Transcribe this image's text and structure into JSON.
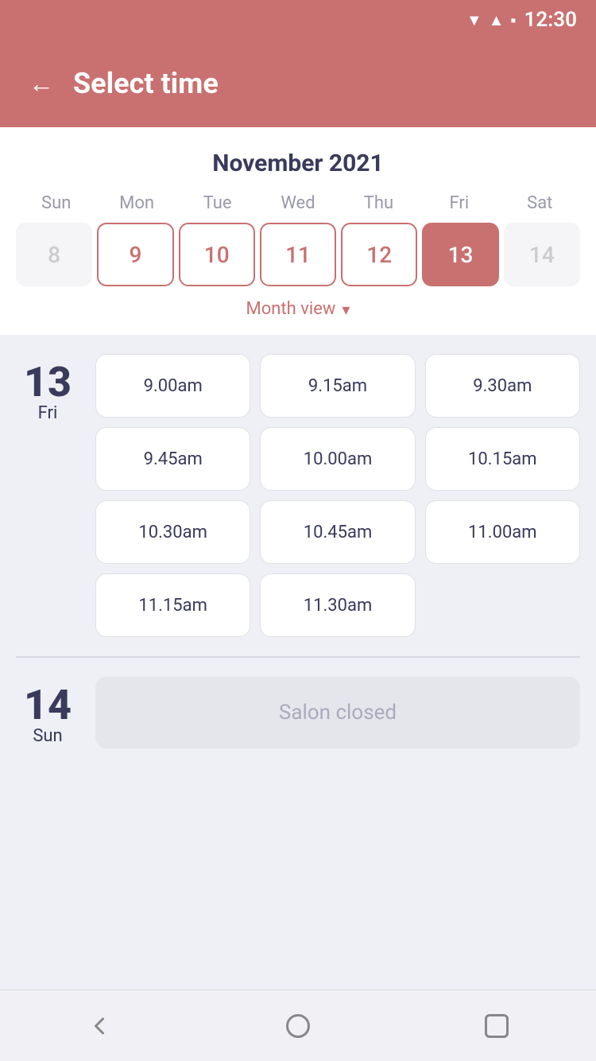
{
  "statusBar": {
    "time": "12:30"
  },
  "header": {
    "title": "Select time",
    "backLabel": "←"
  },
  "calendar": {
    "monthYear": "November 2021",
    "dayHeaders": [
      "Sun",
      "Mon",
      "Tue",
      "Wed",
      "Thu",
      "Fri",
      "Sat"
    ],
    "weekDays": [
      {
        "date": "8",
        "state": "inactive"
      },
      {
        "date": "9",
        "state": "available"
      },
      {
        "date": "10",
        "state": "available"
      },
      {
        "date": "11",
        "state": "available"
      },
      {
        "date": "12",
        "state": "available"
      },
      {
        "date": "13",
        "state": "selected"
      },
      {
        "date": "14",
        "state": "inactive"
      }
    ],
    "monthViewLabel": "Month view"
  },
  "day13": {
    "number": "13",
    "name": "Fri",
    "slots": [
      "9.00am",
      "9.15am",
      "9.30am",
      "9.45am",
      "10.00am",
      "10.15am",
      "10.30am",
      "10.45am",
      "11.00am",
      "11.15am",
      "11.30am"
    ]
  },
  "day14": {
    "number": "14",
    "name": "Sun",
    "closedLabel": "Salon closed"
  }
}
